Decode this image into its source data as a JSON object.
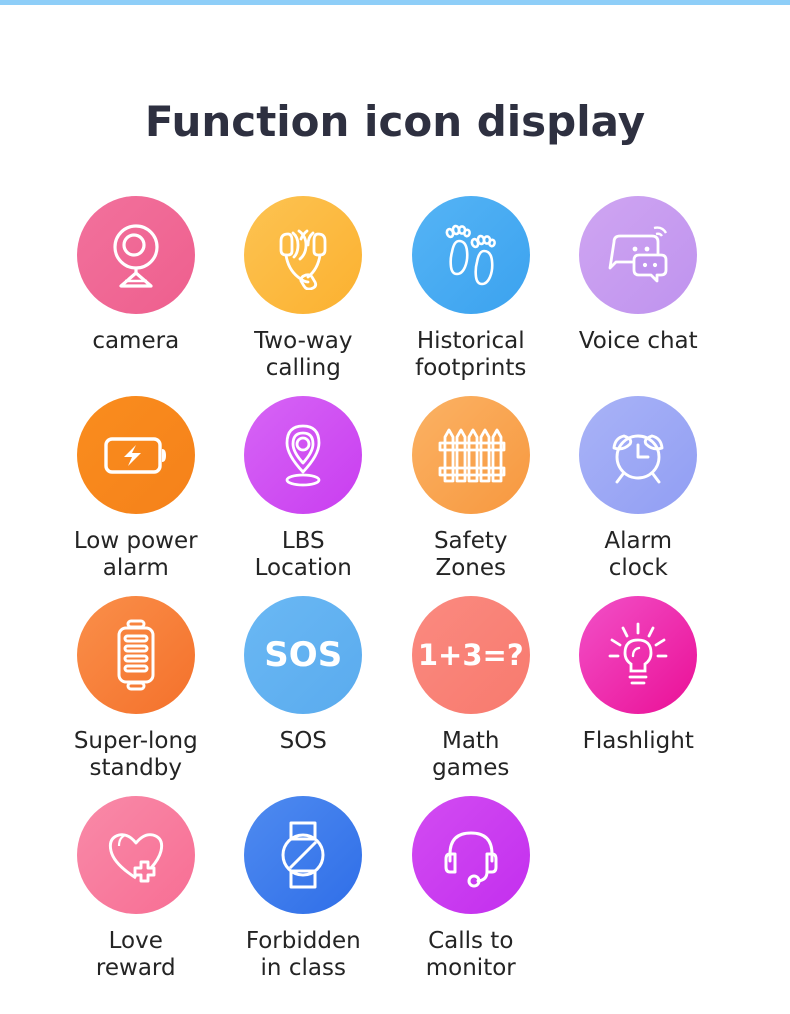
{
  "header": {
    "title": "Function icon display",
    "accent_bar_color": "#8ecef8",
    "title_color": "#2e3040"
  },
  "label_color": "#242424",
  "grid": {
    "columns": 4,
    "rows": 4,
    "items": [
      {
        "label": "camera",
        "icon": "webcam-icon",
        "color_start": "#f2719c",
        "color_end": "#ee5f8e",
        "text_in_icon": ""
      },
      {
        "label": "Two-way\ncalling",
        "icon": "two-way-call-icon",
        "color_start": "#fdc352",
        "color_end": "#fbb130",
        "text_in_icon": ""
      },
      {
        "label": "Historical\nfootprints",
        "icon": "footprints-icon",
        "color_start": "#55b4f5",
        "color_end": "#3ba2ef",
        "text_in_icon": ""
      },
      {
        "label": "Voice chat",
        "icon": "speech-bubbles-icon",
        "color_start": "#cfa5f2",
        "color_end": "#bf93ee",
        "text_in_icon": ""
      },
      {
        "label": "Low power\nalarm",
        "icon": "battery-bolt-icon",
        "color_start": "#fa8d1e",
        "color_end": "#f5811a",
        "text_in_icon": ""
      },
      {
        "label": "LBS\nLocation",
        "icon": "map-pin-icon",
        "color_start": "#d665f5",
        "color_end": "#c93df0",
        "text_in_icon": ""
      },
      {
        "label": "Safety\nZones",
        "icon": "fence-icon",
        "color_start": "#fbb264",
        "color_end": "#f7983f",
        "text_in_icon": ""
      },
      {
        "label": "Alarm\nclock",
        "icon": "alarm-clock-icon",
        "color_start": "#a9b3f7",
        "color_end": "#919ef3",
        "text_in_icon": ""
      },
      {
        "label": "Super-long\nstandby",
        "icon": "battery-bars-icon",
        "color_start": "#fa8f4a",
        "color_end": "#f4712b",
        "text_in_icon": ""
      },
      {
        "label": "SOS",
        "icon": "sos-text-icon",
        "color_start": "#6ab8f4",
        "color_end": "#5aabee",
        "text_in_icon": "SOS"
      },
      {
        "label": "Math\ngames",
        "icon": "math-text-icon",
        "color_start": "#fa8a80",
        "color_end": "#f87a6e",
        "text_in_icon": "1+3=?"
      },
      {
        "label": "Flashlight",
        "icon": "lightbulb-icon",
        "color_start": "#f251c8",
        "color_end": "#ea0f96",
        "text_in_icon": ""
      },
      {
        "label": "Love\nreward",
        "icon": "heart-plus-icon",
        "color_start": "#f98aa8",
        "color_end": "#f76e94",
        "text_in_icon": ""
      },
      {
        "label": "Forbidden\nin class",
        "icon": "watch-forbidden-icon",
        "color_start": "#4f8bf0",
        "color_end": "#2f6ee8",
        "text_in_icon": ""
      },
      {
        "label": "Calls to\nmonitor",
        "icon": "headset-icon",
        "color_start": "#d24cf2",
        "color_end": "#c32eee",
        "text_in_icon": ""
      }
    ]
  }
}
